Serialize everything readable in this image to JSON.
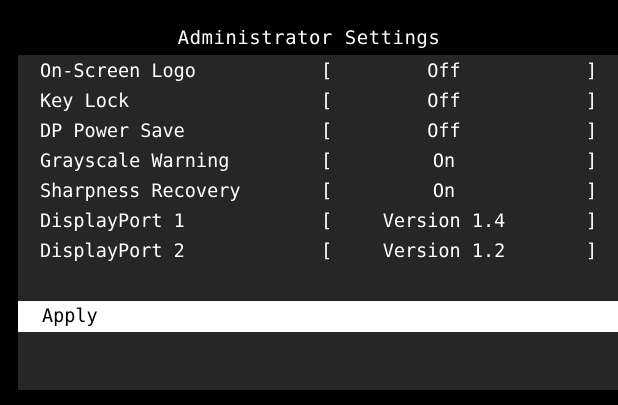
{
  "window": {
    "title": "Administrator Settings"
  },
  "settings": [
    {
      "label": "On-Screen Logo",
      "value": "Off"
    },
    {
      "label": "Key Lock",
      "value": "Off"
    },
    {
      "label": "DP Power Save",
      "value": "Off"
    },
    {
      "label": "Grayscale Warning",
      "value": "On"
    },
    {
      "label": "Sharpness Recovery",
      "value": "On"
    },
    {
      "label": "DisplayPort 1",
      "value": "Version 1.4"
    },
    {
      "label": "DisplayPort 2",
      "value": "Version 1.2"
    }
  ],
  "brackets": {
    "open": "[",
    "close": "]"
  },
  "apply": {
    "label": "Apply"
  },
  "colors": {
    "frame": "#000000",
    "panel": "#262626",
    "title_bar": "#000000",
    "text": "#ffffff",
    "highlight": "#ffffff",
    "highlight_text": "#000000"
  }
}
